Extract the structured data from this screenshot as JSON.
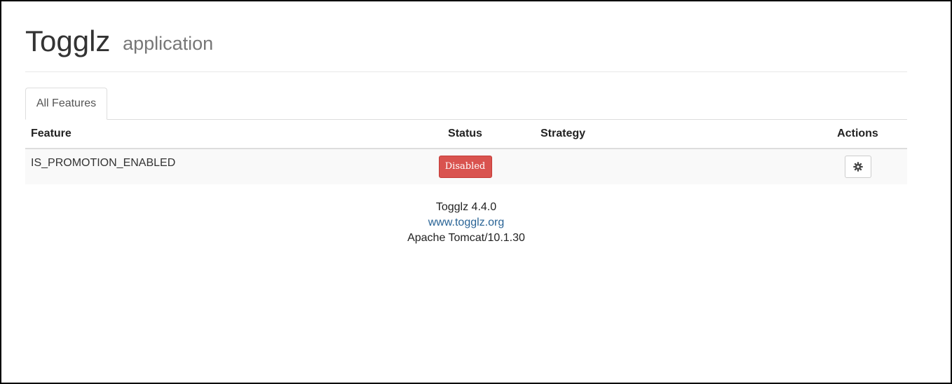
{
  "header": {
    "title": "Togglz",
    "subtitle": "application"
  },
  "tabs": [
    {
      "label": "All Features",
      "active": true
    }
  ],
  "table": {
    "columns": [
      "Feature",
      "Status",
      "Strategy",
      "Actions"
    ],
    "rows": [
      {
        "feature": "IS_PROMOTION_ENABLED",
        "status": "Disabled",
        "strategy": "",
        "action_icon": "gear-icon"
      }
    ]
  },
  "footer": {
    "version": "Togglz 4.4.0",
    "link": "www.togglz.org",
    "server": "Apache Tomcat/10.1.30"
  },
  "colors": {
    "disabled_badge": "#d9534f",
    "link": "#2a6496"
  }
}
